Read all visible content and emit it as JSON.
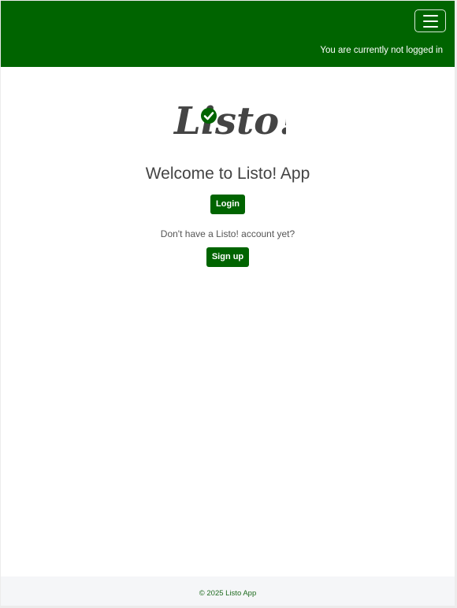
{
  "navbar": {
    "background_color": "#006400",
    "menu_icon": "hamburger-menu-icon",
    "login_status": "You are currently not logged in"
  },
  "logo": {
    "text": "Listo!",
    "check_icon": "check-circle-icon",
    "color": "#444444",
    "accent": "#006400"
  },
  "main": {
    "welcome": "Welcome to Listo! App",
    "login_label": "Login",
    "signup_prompt": "Don't have a Listo! account yet?",
    "signup_label": "Sign up"
  },
  "footer": {
    "text": "© 2025 Listo App"
  }
}
